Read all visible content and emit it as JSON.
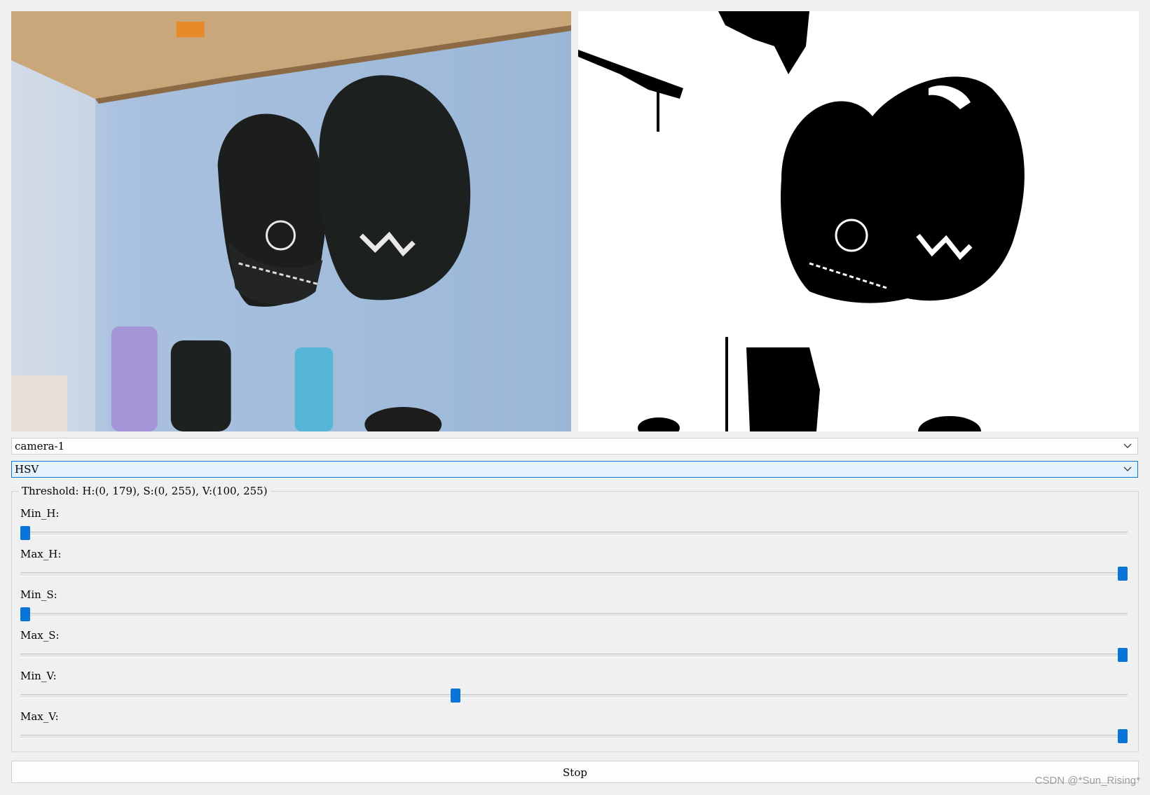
{
  "camera_select": {
    "value": "camera-1"
  },
  "mode_select": {
    "value": "HSV"
  },
  "threshold": {
    "title": "Threshold: H:(0, 179), S:(0, 255), V:(100, 255)",
    "sliders": [
      {
        "label": "Min_H:",
        "value": 0,
        "max": 179
      },
      {
        "label": "Max_H:",
        "value": 179,
        "max": 179
      },
      {
        "label": "Min_S:",
        "value": 0,
        "max": 255
      },
      {
        "label": "Max_S:",
        "value": 255,
        "max": 255
      },
      {
        "label": "Min_V:",
        "value": 100,
        "max": 255
      },
      {
        "label": "Max_V:",
        "value": 255,
        "max": 255
      }
    ]
  },
  "stop_button": {
    "label": "Stop"
  },
  "watermark": "CSDN @*Sun_Rising*",
  "colors": {
    "accent": "#0a74d9",
    "focus_border": "#0a7ad6"
  }
}
